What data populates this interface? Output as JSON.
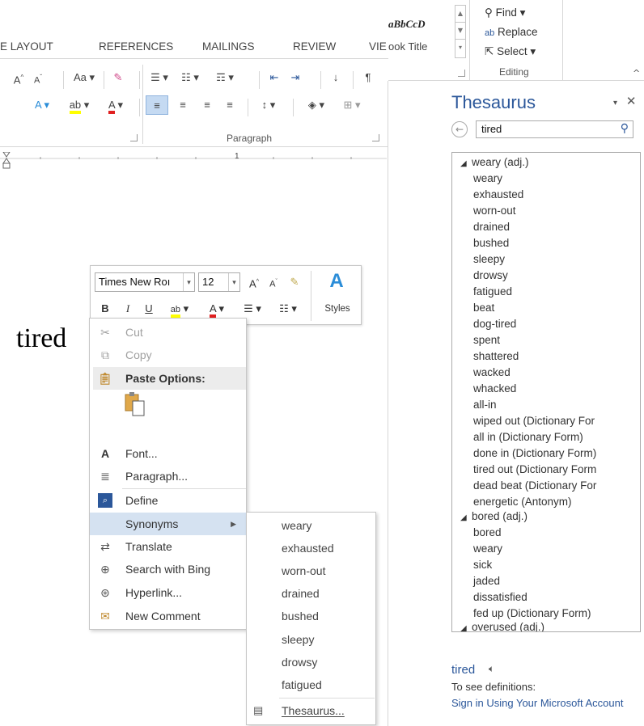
{
  "ribbon": {
    "tabs": [
      "E LAYOUT",
      "REFERENCES",
      "MAILINGS",
      "REVIEW",
      "VIE"
    ],
    "font_buttons": {
      "grow": "A",
      "shrink": "A",
      "change_case": "Aa",
      "effects": "A",
      "highlight": "ab",
      "font_color": "A"
    },
    "paragraph_label": "Paragraph",
    "paragraph_mark": "¶",
    "styles_gallery": {
      "preview": "aBbCcD",
      "title": "ook Title"
    },
    "editing": {
      "find": "Find",
      "replace": "Replace",
      "select": "Select",
      "label": "Editing"
    },
    "ruler_mark": "1"
  },
  "document": {
    "word": "tired"
  },
  "mini_toolbar": {
    "font_name": "Times New Roı",
    "font_size": "12",
    "bold": "B",
    "italic": "I",
    "underline": "U",
    "styles_label": "Styles"
  },
  "context_menu": {
    "items": [
      {
        "label": "Cut",
        "disabled": true
      },
      {
        "label": "Copy",
        "disabled": true
      },
      {
        "label": "Paste Options:"
      },
      {
        "label": "Font..."
      },
      {
        "label": "Paragraph..."
      },
      {
        "label": "Define"
      },
      {
        "label": "Synonyms"
      },
      {
        "label": "Translate"
      },
      {
        "label": "Search with Bing"
      },
      {
        "label": "Hyperlink..."
      },
      {
        "label": "New Comment"
      }
    ]
  },
  "synonyms_submenu": {
    "items": [
      "weary",
      "exhausted",
      "worn-out",
      "drained",
      "bushed",
      "sleepy",
      "drowsy",
      "fatigued"
    ],
    "thesaurus": "Thesaurus..."
  },
  "thesaurus_pane": {
    "title": "Thesaurus",
    "search_value": "tired",
    "groups": [
      {
        "heading": "weary (adj.)",
        "items": [
          "weary",
          "exhausted",
          "worn-out",
          "drained",
          "bushed",
          "sleepy",
          "drowsy",
          "fatigued",
          "beat",
          "dog-tired",
          "spent",
          "shattered",
          "wacked",
          "whacked",
          "all-in",
          "wiped out (Dictionary For",
          "all in (Dictionary Form)",
          "done in (Dictionary Form)",
          "tired out (Dictionary Form",
          "dead beat (Dictionary For",
          "energetic (Antonym)"
        ]
      },
      {
        "heading": "bored (adj.)",
        "items": [
          "bored",
          "weary",
          "sick",
          "jaded",
          "dissatisfied",
          "fed up (Dictionary Form)"
        ]
      },
      {
        "heading": "overused (adj.)",
        "items": []
      }
    ],
    "definition_word": "tired",
    "definition_note": "To see definitions:",
    "definition_link": "Sign in Using Your Microsoft Account"
  },
  "colors": {
    "accent": "#2b579a",
    "highlight": "#d5e2f1"
  }
}
